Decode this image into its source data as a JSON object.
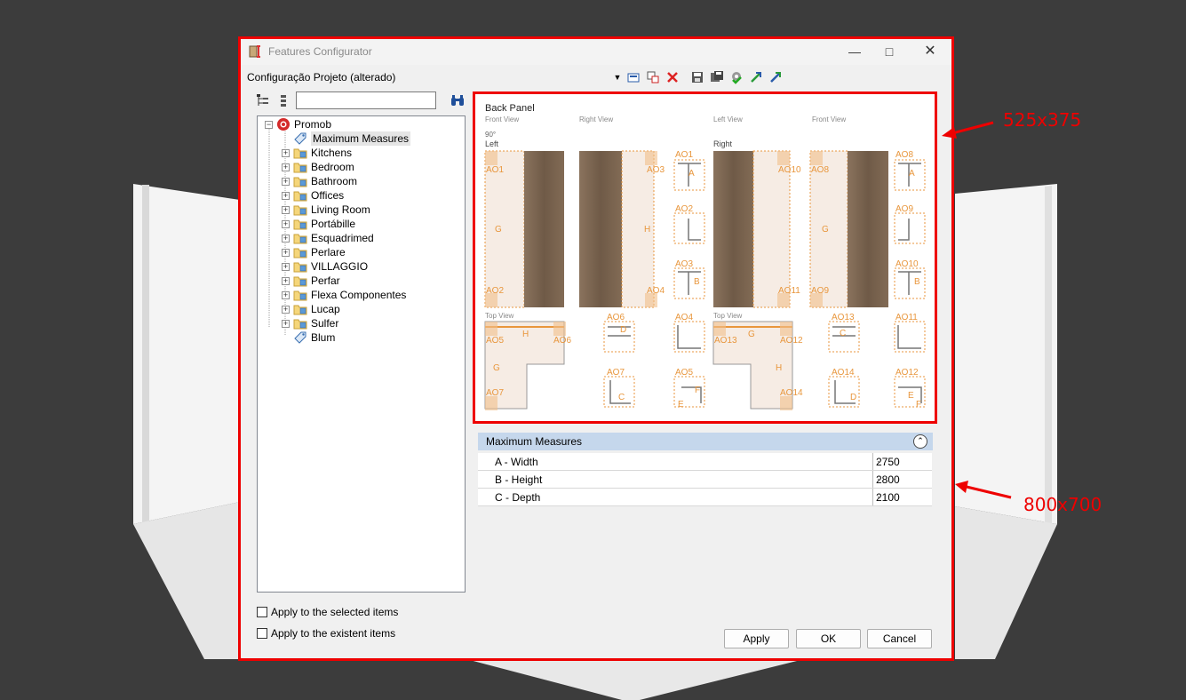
{
  "window": {
    "title": "Features Configurator"
  },
  "config_bar": {
    "label": "Configuração Projeto (alterado)"
  },
  "tree": {
    "root": "Promob",
    "items": [
      "Maximum Measures",
      "Kitchens",
      "Bedroom",
      "Bathroom",
      "Offices",
      "Living Room",
      "Portábille",
      "Esquadrimed",
      "Perlare",
      "VILLAGGIO",
      "Perfar",
      "Flexa Componentes",
      "Lucap",
      "Sulfer",
      "Blum"
    ]
  },
  "options": {
    "apply_selected": "Apply to the selected items",
    "apply_existent": "Apply to the existent items"
  },
  "preview": {
    "title": "Back Panel",
    "views": {
      "front1": "Front View",
      "right": "Right View",
      "left": "Left View",
      "front2": "Front View",
      "top1": "Top View",
      "top2": "Top View"
    },
    "angle": "90°",
    "left_label": "Left",
    "right_label": "Right",
    "letters": {
      "a": "A",
      "b": "B",
      "c": "C",
      "d": "D",
      "e": "E",
      "f": "F",
      "g": "G",
      "h": "H"
    },
    "codes": [
      "AO1",
      "AO2",
      "AO3",
      "AO4",
      "AO5",
      "AO6",
      "AO7",
      "AO8",
      "AO9",
      "AO10",
      "AO11",
      "AO12",
      "AO13",
      "AO14"
    ]
  },
  "properties": {
    "section": "Maximum Measures",
    "rows": [
      {
        "name": "A - Width",
        "value": "2750"
      },
      {
        "name": "B - Height",
        "value": "2800"
      },
      {
        "name": "C - Depth",
        "value": "2100"
      }
    ]
  },
  "buttons": {
    "apply": "Apply",
    "ok": "OK",
    "cancel": "Cancel"
  },
  "annotations": {
    "preview_size": "525x375",
    "window_size": "800x700"
  },
  "colors": {
    "accent_red": "#e00000",
    "orange": "#e8963c",
    "wood": "#7a6450",
    "section_header": "#c5d7ec"
  }
}
